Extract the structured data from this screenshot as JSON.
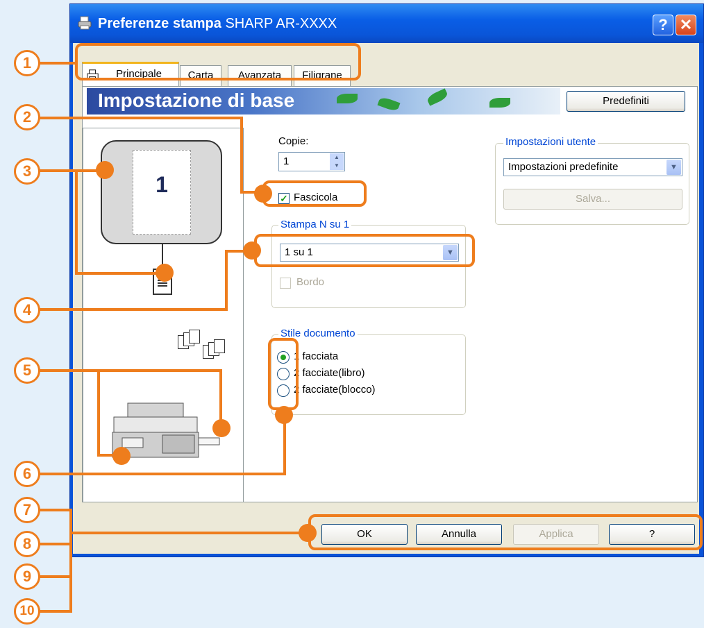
{
  "window": {
    "title_bold": "Preferenze stampa",
    "title_rest": "SHARP AR-XXXX",
    "help_btn": "?",
    "close_btn": "✕"
  },
  "tabs": [
    {
      "label": "Principale",
      "active": true
    },
    {
      "label": "Carta"
    },
    {
      "label": "Avanzata"
    },
    {
      "label": "Filigrane"
    }
  ],
  "banner": {
    "title": "Impostazione di base"
  },
  "defaults_button": "Predefiniti",
  "copies": {
    "label": "Copie:",
    "value": "1"
  },
  "collate": {
    "label": "Fascicola",
    "checked": true
  },
  "n_up": {
    "group_title": "Stampa N su 1",
    "selected": "1 su 1",
    "border_label": "Bordo"
  },
  "doc_style": {
    "group_title": "Stile documento",
    "options": [
      "1 facciata",
      "2 facciate(libro)",
      "2 facciate(blocco)"
    ],
    "selected": "1 facciata"
  },
  "user_settings": {
    "group_title": "Impostazioni utente",
    "selected": "Impostazioni predefinite",
    "save_button": "Salva..."
  },
  "preview": {
    "page_number": "1"
  },
  "footer": {
    "ok": "OK",
    "cancel": "Annulla",
    "apply": "Applica",
    "help": "?"
  },
  "callouts": [
    "1",
    "2",
    "3",
    "4",
    "5",
    "6",
    "7",
    "8",
    "9",
    "10"
  ],
  "colors": {
    "accent": "#ee7d1d",
    "title_bar": "#0a55d8",
    "page_bg": "#e4f0fa"
  }
}
